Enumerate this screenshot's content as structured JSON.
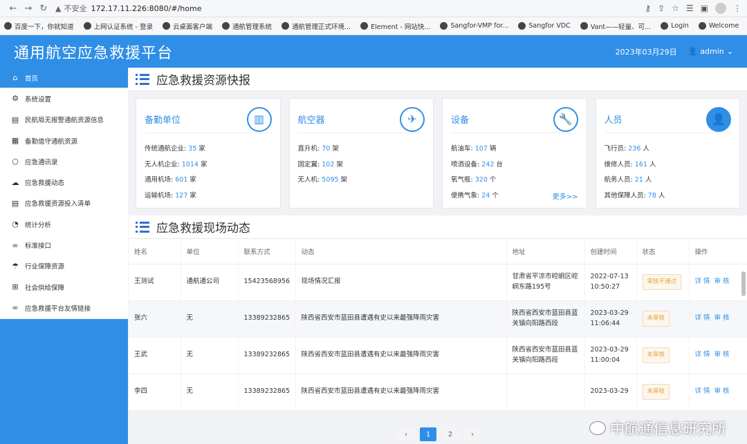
{
  "browser": {
    "back": "←",
    "forward": "→",
    "reload": "↻",
    "insecure_label": "不安全",
    "url": "172.17.11.226:8080/#/home"
  },
  "bookmarks": [
    "百度一下，你就知道",
    "上网认证系统 - 登录",
    "云桌面客户端",
    "通航管理系统",
    "通航管理正式环境...",
    "Element - 网站快...",
    "Sangfor-VMP for...",
    "Sangfor VDC",
    "Vant——轻量、可...",
    "Login",
    "Welcome"
  ],
  "bookmarks_more": "»",
  "header": {
    "title": "通用航空应急救援平台",
    "date": "2023年03月29日",
    "user": "admin"
  },
  "sidebar": {
    "items": [
      {
        "label": "首页",
        "icon": "home-icon"
      },
      {
        "label": "系统设置",
        "icon": "gear-icon"
      },
      {
        "label": "民航局无报警通航资源信息",
        "icon": "document-icon"
      },
      {
        "label": "备勤值守通航资源",
        "icon": "calendar-icon"
      },
      {
        "label": "应急通讯录",
        "icon": "search-icon"
      },
      {
        "label": "应急救援动态",
        "icon": "cloud-icon"
      },
      {
        "label": "应急救援资源投入清单",
        "icon": "list-icon"
      },
      {
        "label": "统计分析",
        "icon": "pie-icon"
      },
      {
        "label": "标准接口",
        "icon": "link-icon"
      },
      {
        "label": "行业保障资源",
        "icon": "umbrella-icon"
      },
      {
        "label": "社会供给保障",
        "icon": "gift-icon"
      },
      {
        "label": "应急救援平台友情链接",
        "icon": "link-icon"
      }
    ]
  },
  "resources": {
    "title": "应急救援资源快报",
    "cards": [
      {
        "title": "备勤单位",
        "icon": "building-icon",
        "rows": [
          {
            "label": "传统通航企业: ",
            "num": "35",
            "unit": " 家"
          },
          {
            "label": "无人机企业: ",
            "num": "1014",
            "unit": " 家"
          },
          {
            "label": "通用机场: ",
            "num": "601",
            "unit": " 家"
          },
          {
            "label": "运输机场: ",
            "num": "127",
            "unit": " 家"
          }
        ],
        "more": ""
      },
      {
        "title": "航空器",
        "icon": "helicopter-icon",
        "rows": [
          {
            "label": "直升机: ",
            "num": "70",
            "unit": " 架"
          },
          {
            "label": "固定翼: ",
            "num": "102",
            "unit": " 架"
          },
          {
            "label": "无人机: ",
            "num": "5095",
            "unit": " 架"
          }
        ],
        "more": ""
      },
      {
        "title": "设备",
        "icon": "wrench-icon",
        "rows": [
          {
            "label": "航油车: ",
            "num": "107",
            "unit": " 辆"
          },
          {
            "label": "喷洒设备: ",
            "num": "242",
            "unit": " 台"
          },
          {
            "label": "氧气瓶: ",
            "num": "320",
            "unit": " 个"
          },
          {
            "label": "便携气象: ",
            "num": "24",
            "unit": " 个"
          }
        ],
        "more": "更多>>"
      },
      {
        "title": "人员",
        "icon": "person-icon",
        "rows": [
          {
            "label": "飞行员: ",
            "num": "236",
            "unit": " 人"
          },
          {
            "label": "维修人员: ",
            "num": "161",
            "unit": " 人"
          },
          {
            "label": "航务人员: ",
            "num": "21",
            "unit": " 人"
          },
          {
            "label": "其他保障人员: ",
            "num": "78",
            "unit": " 人"
          }
        ],
        "more": ""
      }
    ]
  },
  "dynamics": {
    "title": "应急救援现场动态",
    "columns": [
      "姓名",
      "单位",
      "联系方式",
      "动态",
      "地址",
      "创建时间",
      "状态",
      "操作"
    ],
    "rows": [
      {
        "name": "王测试",
        "unit": "通航通公司",
        "phone": "15423568956",
        "dynamic": "现场情况汇报",
        "address": "甘肃省平凉市崆峒区崆峒东路195号",
        "time": "2022-07-13 10:50:27",
        "status": "审核不通过",
        "op1": "详 情",
        "op2": "审 核"
      },
      {
        "name": "张六",
        "unit": "无",
        "phone": "13389232865",
        "dynamic": "陕西省西安市蓝田县遭遇有史以来最强降雨灾害",
        "address": "陕西省西安市蓝田县蓝关镇向阳路西段",
        "time": "2023-03-29 11:06:44",
        "status": "未审核",
        "op1": "详 情",
        "op2": "审 核"
      },
      {
        "name": "王武",
        "unit": "无",
        "phone": "13389232865",
        "dynamic": "陕西省西安市蓝田县遭遇有史以来最强降雨灾害",
        "address": "陕西省西安市蓝田县蓝关镇向阳路西段",
        "time": "2023-03-29 11:00:04",
        "status": "未审核",
        "op1": "详 情",
        "op2": "审 核"
      },
      {
        "name": "李四",
        "unit": "无",
        "phone": "13389232865",
        "dynamic": "陕西省西安市蓝田县遭遇有史以来最强降雨灾害",
        "address": "",
        "time": "2023-03-29",
        "status": "未审核",
        "op1": "详 情",
        "op2": "审 核"
      }
    ]
  },
  "pagination": {
    "prev": "‹",
    "pages": [
      "1",
      "2"
    ],
    "next": "›",
    "current": "1"
  },
  "watermark": "中航通信息研究所",
  "colors": {
    "primary": "#2f8ee6",
    "warning": "#e6a23c"
  }
}
